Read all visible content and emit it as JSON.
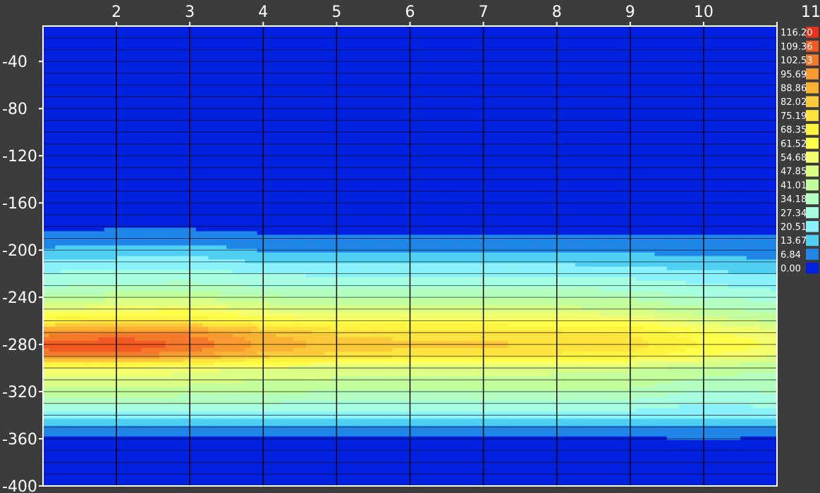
{
  "chart_data": {
    "type": "heatmap",
    "title": "",
    "xlabel": "",
    "ylabel": "",
    "xlim": [
      1,
      11
    ],
    "ylim": [
      -400,
      -10
    ],
    "x_ticks": [
      "2",
      "3",
      "4",
      "5",
      "6",
      "7",
      "8",
      "9",
      "10",
      "11"
    ],
    "y_ticks": [
      "-40",
      "-80",
      "-120",
      "-160",
      "-200",
      "-240",
      "-280",
      "-320",
      "-360",
      "-400"
    ],
    "y_tick_values": [
      -40,
      -80,
      -120,
      -160,
      -200,
      -240,
      -280,
      -320,
      -360,
      -400
    ],
    "x": [
      1,
      2,
      3,
      4,
      5,
      6,
      7,
      8,
      9,
      10,
      11
    ],
    "depth": [
      -10,
      -120,
      -170,
      -180,
      -190,
      -200,
      -210,
      -220,
      -230,
      -240,
      -250,
      -260,
      -265,
      -270,
      -275,
      -280,
      -285,
      -290,
      -295,
      -300,
      -310,
      -320,
      -330,
      -340,
      -350,
      -360,
      -370,
      -400
    ],
    "values": [
      [
        0,
        0,
        0,
        0,
        0,
        0,
        0,
        0,
        0,
        0,
        0
      ],
      [
        0,
        0,
        0,
        0,
        0,
        0,
        0,
        0,
        0,
        0,
        0
      ],
      [
        0,
        0,
        0,
        0,
        0,
        0,
        0,
        0,
        0,
        0,
        0
      ],
      [
        5,
        6,
        6,
        4,
        2,
        2,
        3,
        3,
        3,
        4,
        3
      ],
      [
        9,
        10,
        10,
        9,
        8,
        8,
        9,
        9,
        9,
        9,
        8
      ],
      [
        15,
        16,
        17,
        13,
        12,
        12,
        12,
        12,
        12,
        11,
        10
      ],
      [
        22,
        23,
        24,
        20,
        19,
        19,
        19,
        19,
        18,
        16,
        15
      ],
      [
        28,
        29,
        30,
        27,
        26,
        26,
        26,
        26,
        25,
        22,
        20
      ],
      [
        33,
        35,
        36,
        33,
        32,
        32,
        32,
        32,
        31,
        28,
        25
      ],
      [
        42,
        45,
        46,
        42,
        40,
        40,
        40,
        40,
        39,
        34,
        31
      ],
      [
        55,
        58,
        60,
        53,
        50,
        50,
        50,
        50,
        48,
        42,
        38
      ],
      [
        72,
        76,
        74,
        66,
        63,
        63,
        63,
        63,
        61,
        52,
        46
      ],
      [
        85,
        90,
        88,
        78,
        72,
        71,
        71,
        70,
        68,
        58,
        52
      ],
      [
        98,
        103,
        100,
        88,
        80,
        78,
        78,
        76,
        74,
        63,
        56
      ],
      [
        106,
        110,
        106,
        92,
        84,
        81,
        81,
        79,
        77,
        66,
        59
      ],
      [
        111,
        115,
        108,
        94,
        86,
        83,
        84,
        80,
        78,
        68,
        60
      ],
      [
        109,
        112,
        104,
        92,
        84,
        81,
        81,
        78,
        76,
        66,
        58
      ],
      [
        98,
        102,
        95,
        84,
        78,
        76,
        76,
        73,
        70,
        61,
        54
      ],
      [
        78,
        80,
        76,
        68,
        64,
        63,
        62,
        60,
        58,
        52,
        47
      ],
      [
        60,
        61,
        58,
        54,
        52,
        51,
        51,
        50,
        49,
        45,
        42
      ],
      [
        52,
        52,
        51,
        48,
        47,
        46,
        46,
        46,
        45,
        40,
        38
      ],
      [
        45,
        45,
        44,
        42,
        41,
        41,
        41,
        40,
        40,
        33,
        35
      ],
      [
        36,
        36,
        35,
        34,
        33,
        33,
        33,
        33,
        32,
        27,
        30
      ],
      [
        25,
        25,
        24,
        24,
        24,
        24,
        24,
        24,
        24,
        22,
        22
      ],
      [
        14,
        14,
        13,
        13,
        13,
        13,
        13,
        13,
        13,
        13,
        13
      ],
      [
        6,
        6,
        5,
        6,
        6,
        6,
        6,
        6,
        6,
        7,
        6
      ],
      [
        0,
        0,
        0,
        0,
        0,
        0,
        0,
        0,
        0,
        0,
        0
      ],
      [
        0,
        0,
        0,
        0,
        0,
        0,
        0,
        0,
        0,
        0,
        0
      ]
    ],
    "legend": {
      "levels": [
        "116.20",
        "109.36",
        "102.53",
        "95.69",
        "88.86",
        "82.02",
        "75.19",
        "68.35",
        "61.52",
        "54.68",
        "47.85",
        "41.01",
        "34.18",
        "27.34",
        "20.51",
        "13.67",
        "6.84",
        "0.00"
      ],
      "colors": [
        "#e8301a",
        "#f25a22",
        "#f5792a",
        "#f99a2e",
        "#fbb233",
        "#fcc93a",
        "#fde33c",
        "#fef43f",
        "#ffff49",
        "#f4ff6e",
        "#dbff84",
        "#c2ff9c",
        "#b3ffbf",
        "#a6ffe0",
        "#8af2fb",
        "#4fcff2",
        "#1f86e8",
        "#0022e0"
      ]
    },
    "grid": true
  }
}
